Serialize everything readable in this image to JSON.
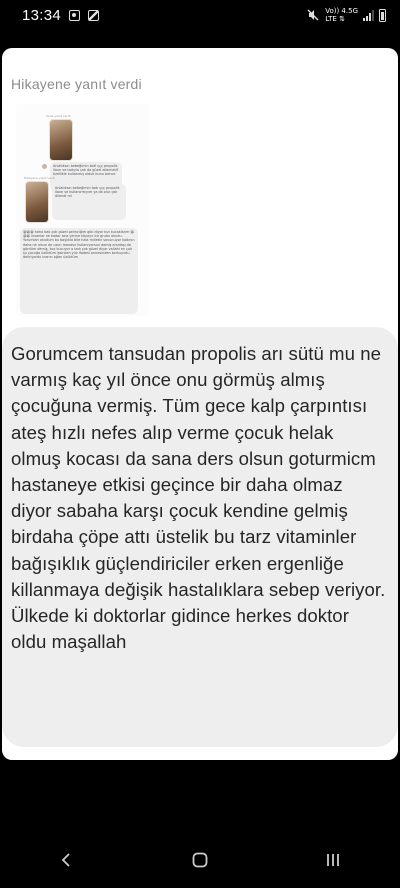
{
  "status_bar": {
    "time": "13:34",
    "network_top": "Vo)) 4.5G",
    "network_bottom": "LTE ⇅",
    "icons": [
      "notification-icon",
      "gallery-icon",
      "mute-icon",
      "signal-icon",
      "battery-icon"
    ]
  },
  "post": {
    "reply_label": "Hikayene yanıt verdi",
    "screenshot": {
      "bubble_1": "Anlatıksın bebeğimin tadi̇ ççç propoliṡ ilaxn ve tadıyla çok da güzel alternatif",
      "bubble_1_extra": "özellikle kullanmış olduk bunu bence",
      "bubble_2": "Anlatıksın bebeğimin tadı ççç propoliṡ ilaxn ve kullanırmıyım ya da olur çok di̇lendi mi",
      "bubble_3": "😀😀😀 haha bak çok güzel pelinciğim gibi diyor kızı kucaklarım 😀😀😀 insanlar ne kadar azız yerine köyayır bir grubu okudu. Yorumları okudum bu başlıkla bile hala milletin savunuyor kadının daha ne olsun de uzun manasır kullanıyorsun demiş arsıdaşı da gördüm demiş, koç kucuyor o tadı çok güzel diyor vallahi en çok şu çocuğa üzüldüm işsinken yüz ifadesi annesinden korkuyudu deliriyordu inanın oğan üzüldüm",
      "meta_1": "Sana yanıt verdi",
      "meta_2": "Hikayene yanıt verdi"
    },
    "message": "Gorumcem tansudan propolis arı sütü mu ne varmış kaç yıl önce onu görmüş almış çocuğuna vermiş. Tüm gece kalp çarpıntısı ateş hızlı nefes alıp verme çocuk helak olmuş kocası da sana ders olsun goturmicm hastaneye etkisi geçince bir daha olmaz diyor sabaha karşı çocuk kendine gelmiş birdaha çöpe attı üstelik bu tarz vitaminler bağışıklık güçlendiriciler erken ergenliğe killanmaya değişik hastalıklara sebep veriyor. Ülkede ki doktorlar gidince herkes doktor oldu maşallah"
  },
  "nav_bar": {
    "buttons": [
      "recent-apps-icon",
      "home-icon",
      "back-icon"
    ]
  },
  "colors": {
    "background": "#000000",
    "card": "#ffffff",
    "bubble": "#eeeeee",
    "text": "#262626",
    "label": "#8c8c8c"
  }
}
